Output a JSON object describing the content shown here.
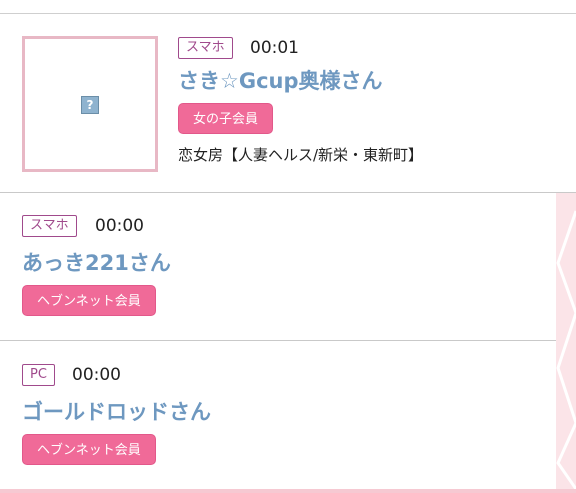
{
  "entries": [
    {
      "device": "スマホ",
      "time": "00:01",
      "name": "さき☆Gcup奥様さん",
      "member_badge": "女の子会員",
      "shop": "恋女房【人妻ヘルス/新栄・東新町】",
      "thumbnail_icon": "broken-image-icon"
    },
    {
      "device": "スマホ",
      "time": "00:00",
      "name": "あっき221さん",
      "member_badge": "ヘブンネット会員"
    },
    {
      "device": "PC",
      "time": "00:00",
      "name": "ゴールドロッドさん",
      "member_badge": "ヘブンネット会員"
    }
  ],
  "broken_image_glyph": "?",
  "colors": {
    "tag_border": "#a04a8c",
    "name_text": "#6e98c0",
    "badge_bg": "#f06a98",
    "thumb_border": "#e8b8c5",
    "edge_pink": "#fbe4e8"
  }
}
